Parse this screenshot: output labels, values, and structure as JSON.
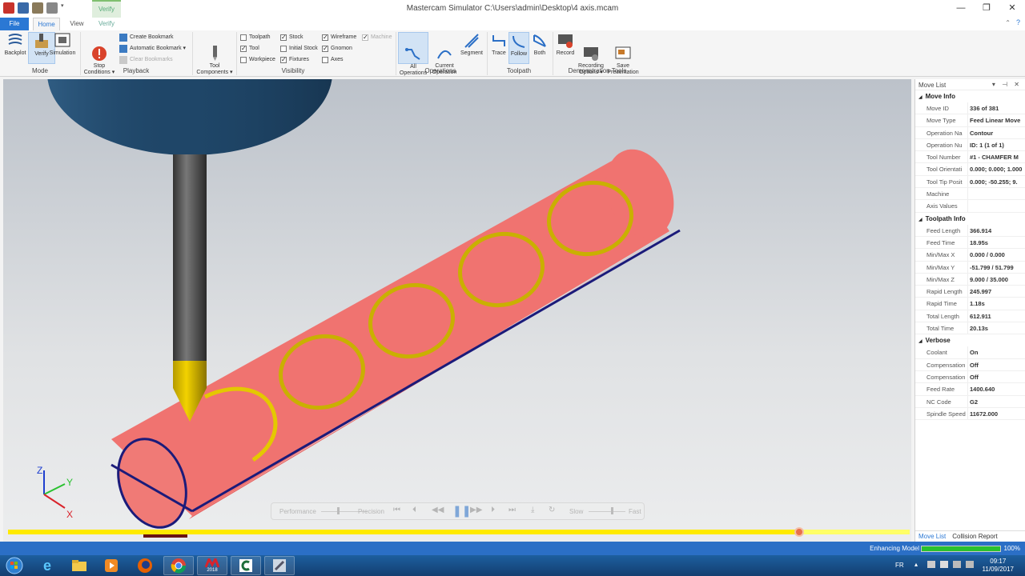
{
  "window": {
    "title": "Mastercam Simulator  C:\\Users\\admin\\Desktop\\4 axis.mcam",
    "contextual_tab_group": "Verify",
    "controls": {
      "minimize": "—",
      "restore": "❐",
      "close": "✕"
    }
  },
  "tabs": [
    {
      "label": "File"
    },
    {
      "label": "Home"
    },
    {
      "label": "View"
    },
    {
      "label": "Verify"
    }
  ],
  "ribbon": {
    "mode": {
      "label": "Mode",
      "buttons": [
        {
          "label": "Backplot",
          "icon": "backplot-icon"
        },
        {
          "label": "Verify",
          "icon": "verify-icon",
          "active": true
        },
        {
          "label": "Simulation",
          "icon": "simulation-icon"
        }
      ]
    },
    "playback": {
      "label": "Playback",
      "stop_conditions": "Stop\nConditions ▾",
      "create_bookmark": "Create Bookmark",
      "automatic_bookmark": "Automatic Bookmark ▾",
      "clear_bookmarks": "Clear Bookmarks"
    },
    "tool_components": "Tool\nComponents ▾",
    "visibility": {
      "label": "Visibility",
      "items": [
        {
          "label": "Toolpath",
          "checked": false
        },
        {
          "label": "Stock",
          "checked": true
        },
        {
          "label": "Wireframe",
          "checked": true
        },
        {
          "label": "Machine",
          "checked": true,
          "disabled": true
        },
        {
          "label": "Tool",
          "checked": true
        },
        {
          "label": "Initial Stock",
          "checked": false
        },
        {
          "label": "Gnomon",
          "checked": true
        },
        {
          "label": "Workpiece",
          "checked": false
        },
        {
          "label": "Fixtures",
          "checked": true
        },
        {
          "label": "Axes",
          "checked": false
        }
      ]
    },
    "operations": {
      "label": "Operations",
      "buttons": [
        {
          "label": "All\nOperations",
          "active": true
        },
        {
          "label": "Current\nOperation"
        },
        {
          "label": "Segment"
        }
      ]
    },
    "toolpath": {
      "label": "Toolpath",
      "buttons": [
        {
          "label": "Trace"
        },
        {
          "label": "Follow",
          "active": true
        },
        {
          "label": "Both"
        }
      ]
    },
    "demo": {
      "label": "Demonstration Tools",
      "buttons": [
        {
          "label": "Record"
        },
        {
          "label": "Recording\nOptions ▾"
        },
        {
          "label": "Save\nPresentation"
        }
      ]
    }
  },
  "playbar": {
    "performance": "Performance",
    "precision": "Precision",
    "slow": "Slow",
    "fast": "Fast",
    "progress": 0.88
  },
  "gnomon": {
    "x": "X",
    "y": "Y",
    "z": "Z"
  },
  "move_list": {
    "title": "Move List",
    "sections": [
      {
        "name": "Move Info",
        "rows": [
          {
            "k": "Move ID",
            "v": "336 of 381"
          },
          {
            "k": "Move Type",
            "v": "Feed Linear Move"
          },
          {
            "k": "Operation Na",
            "v": "Contour"
          },
          {
            "k": "Operation Nu",
            "v": "ID: 1 (1 of 1)"
          },
          {
            "k": "Tool Number",
            "v": "#1 - CHAMFER M"
          },
          {
            "k": "Tool Orientati",
            "v": "0.000; 0.000; 1.000"
          },
          {
            "k": "Tool Tip Posit",
            "v": "0.000; -50.255; 9."
          },
          {
            "k": "Machine",
            "v": ""
          },
          {
            "k": "Axis Values",
            "v": ""
          }
        ]
      },
      {
        "name": "Toolpath Info",
        "rows": [
          {
            "k": "Feed Length",
            "v": "366.914"
          },
          {
            "k": "Feed Time",
            "v": "18.95s"
          },
          {
            "k": "Min/Max X",
            "v": "0.000 / 0.000"
          },
          {
            "k": "Min/Max Y",
            "v": "-51.799 / 51.799"
          },
          {
            "k": "Min/Max Z",
            "v": "9.000 / 35.000"
          },
          {
            "k": "Rapid Length",
            "v": "245.997"
          },
          {
            "k": "Rapid Time",
            "v": "1.18s"
          },
          {
            "k": "Total Length",
            "v": "612.911"
          },
          {
            "k": "Total Time",
            "v": "20.13s"
          }
        ]
      },
      {
        "name": "Verbose",
        "rows": [
          {
            "k": "Coolant",
            "v": "On"
          },
          {
            "k": "Compensation",
            "v": "Off"
          },
          {
            "k": "Compensation",
            "v": "Off"
          },
          {
            "k": "Feed Rate",
            "v": "1400.640"
          },
          {
            "k": "NC Code",
            "v": "G2"
          },
          {
            "k": "Spindle Speed",
            "v": "11672.000"
          }
        ]
      }
    ],
    "bottom_tabs": [
      "Move List",
      "Collision Report"
    ]
  },
  "statusbar": {
    "label": "Enhancing Model",
    "progress": 1.0,
    "percent": "100%"
  },
  "taskbar": {
    "apps": [
      "start-orb-icon",
      "internet-explorer-icon",
      "file-explorer-icon",
      "media-player-icon",
      "firefox-icon",
      "chrome-icon",
      "mastercam-2018-icon",
      "mastercam-icon",
      "simulator-icon"
    ],
    "mastercam_badge": "2018",
    "lang": "FR",
    "time": "09:17",
    "date": "11/09/2017"
  }
}
